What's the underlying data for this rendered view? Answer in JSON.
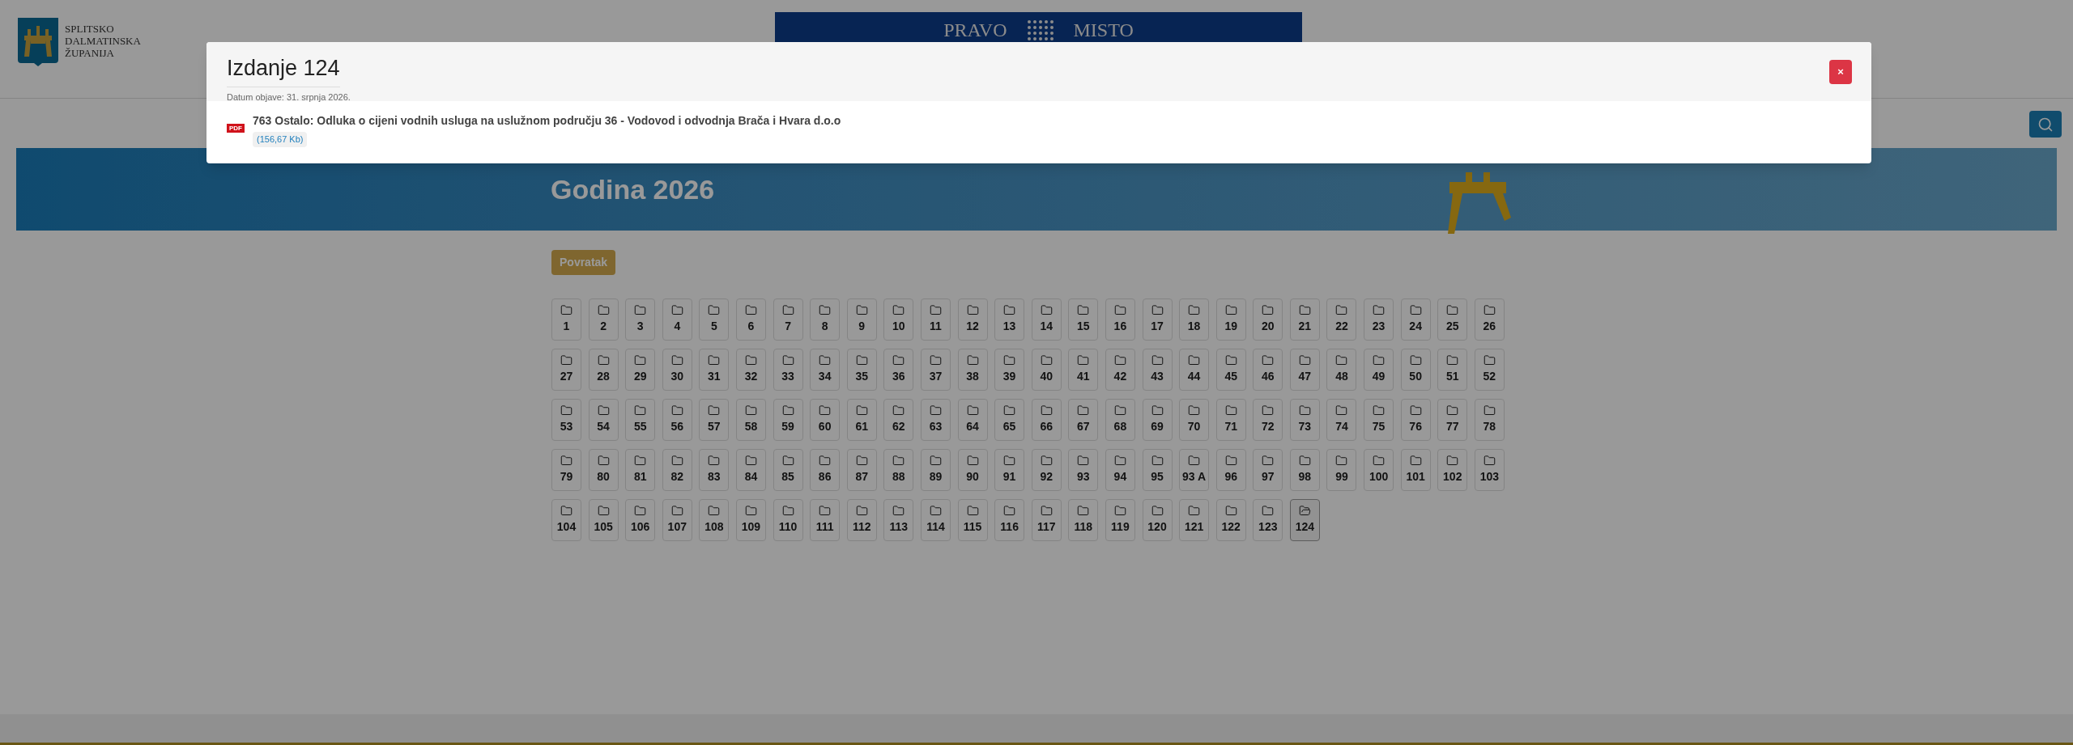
{
  "header": {
    "logo_lines": [
      "SPLITSKO",
      "DALMATINSKA",
      "ŽUPANIJA"
    ],
    "banner_words": [
      "PRAVO",
      "MISTO"
    ]
  },
  "hero": {
    "title": "Godina 2026"
  },
  "back_button": "Povratak",
  "issues": [
    {
      "label": "1",
      "selected": false
    },
    {
      "label": "2",
      "selected": false
    },
    {
      "label": "3",
      "selected": false
    },
    {
      "label": "4",
      "selected": false
    },
    {
      "label": "5",
      "selected": false
    },
    {
      "label": "6",
      "selected": false
    },
    {
      "label": "7",
      "selected": false
    },
    {
      "label": "8",
      "selected": false
    },
    {
      "label": "9",
      "selected": false
    },
    {
      "label": "10",
      "selected": false
    },
    {
      "label": "11",
      "selected": false
    },
    {
      "label": "12",
      "selected": false
    },
    {
      "label": "13",
      "selected": false
    },
    {
      "label": "14",
      "selected": false
    },
    {
      "label": "15",
      "selected": false
    },
    {
      "label": "16",
      "selected": false
    },
    {
      "label": "17",
      "selected": false
    },
    {
      "label": "18",
      "selected": false
    },
    {
      "label": "19",
      "selected": false
    },
    {
      "label": "20",
      "selected": false
    },
    {
      "label": "21",
      "selected": false
    },
    {
      "label": "22",
      "selected": false
    },
    {
      "label": "23",
      "selected": false
    },
    {
      "label": "24",
      "selected": false
    },
    {
      "label": "25",
      "selected": false
    },
    {
      "label": "26",
      "selected": false
    },
    {
      "label": "27",
      "selected": false
    },
    {
      "label": "28",
      "selected": false
    },
    {
      "label": "29",
      "selected": false
    },
    {
      "label": "30",
      "selected": false
    },
    {
      "label": "31",
      "selected": false
    },
    {
      "label": "32",
      "selected": false
    },
    {
      "label": "33",
      "selected": false
    },
    {
      "label": "34",
      "selected": false
    },
    {
      "label": "35",
      "selected": false
    },
    {
      "label": "36",
      "selected": false
    },
    {
      "label": "37",
      "selected": false
    },
    {
      "label": "38",
      "selected": false
    },
    {
      "label": "39",
      "selected": false
    },
    {
      "label": "40",
      "selected": false
    },
    {
      "label": "41",
      "selected": false
    },
    {
      "label": "42",
      "selected": false
    },
    {
      "label": "43",
      "selected": false
    },
    {
      "label": "44",
      "selected": false
    },
    {
      "label": "45",
      "selected": false
    },
    {
      "label": "46",
      "selected": false
    },
    {
      "label": "47",
      "selected": false
    },
    {
      "label": "48",
      "selected": false
    },
    {
      "label": "49",
      "selected": false
    },
    {
      "label": "50",
      "selected": false
    },
    {
      "label": "51",
      "selected": false
    },
    {
      "label": "52",
      "selected": false
    },
    {
      "label": "53",
      "selected": false
    },
    {
      "label": "54",
      "selected": false
    },
    {
      "label": "55",
      "selected": false
    },
    {
      "label": "56",
      "selected": false
    },
    {
      "label": "57",
      "selected": false
    },
    {
      "label": "58",
      "selected": false
    },
    {
      "label": "59",
      "selected": false
    },
    {
      "label": "60",
      "selected": false
    },
    {
      "label": "61",
      "selected": false
    },
    {
      "label": "62",
      "selected": false
    },
    {
      "label": "63",
      "selected": false
    },
    {
      "label": "64",
      "selected": false
    },
    {
      "label": "65",
      "selected": false
    },
    {
      "label": "66",
      "selected": false
    },
    {
      "label": "67",
      "selected": false
    },
    {
      "label": "68",
      "selected": false
    },
    {
      "label": "69",
      "selected": false
    },
    {
      "label": "70",
      "selected": false
    },
    {
      "label": "71",
      "selected": false
    },
    {
      "label": "72",
      "selected": false
    },
    {
      "label": "73",
      "selected": false
    },
    {
      "label": "74",
      "selected": false
    },
    {
      "label": "75",
      "selected": false
    },
    {
      "label": "76",
      "selected": false
    },
    {
      "label": "77",
      "selected": false
    },
    {
      "label": "78",
      "selected": false
    },
    {
      "label": "79",
      "selected": false
    },
    {
      "label": "80",
      "selected": false
    },
    {
      "label": "81",
      "selected": false
    },
    {
      "label": "82",
      "selected": false
    },
    {
      "label": "83",
      "selected": false
    },
    {
      "label": "84",
      "selected": false
    },
    {
      "label": "85",
      "selected": false
    },
    {
      "label": "86",
      "selected": false
    },
    {
      "label": "87",
      "selected": false
    },
    {
      "label": "88",
      "selected": false
    },
    {
      "label": "89",
      "selected": false
    },
    {
      "label": "90",
      "selected": false
    },
    {
      "label": "91",
      "selected": false
    },
    {
      "label": "92",
      "selected": false
    },
    {
      "label": "93",
      "selected": false
    },
    {
      "label": "94",
      "selected": false
    },
    {
      "label": "95",
      "selected": false
    },
    {
      "label": "93 A",
      "selected": false
    },
    {
      "label": "96",
      "selected": false
    },
    {
      "label": "97",
      "selected": false
    },
    {
      "label": "98",
      "selected": false
    },
    {
      "label": "99",
      "selected": false
    },
    {
      "label": "100",
      "selected": false
    },
    {
      "label": "101",
      "selected": false
    },
    {
      "label": "102",
      "selected": false
    },
    {
      "label": "103",
      "selected": false
    },
    {
      "label": "104",
      "selected": false
    },
    {
      "label": "105",
      "selected": false
    },
    {
      "label": "106",
      "selected": false
    },
    {
      "label": "107",
      "selected": false
    },
    {
      "label": "108",
      "selected": false
    },
    {
      "label": "109",
      "selected": false
    },
    {
      "label": "110",
      "selected": false
    },
    {
      "label": "111",
      "selected": false
    },
    {
      "label": "112",
      "selected": false
    },
    {
      "label": "113",
      "selected": false
    },
    {
      "label": "114",
      "selected": false
    },
    {
      "label": "115",
      "selected": false
    },
    {
      "label": "116",
      "selected": false
    },
    {
      "label": "117",
      "selected": false
    },
    {
      "label": "118",
      "selected": false
    },
    {
      "label": "119",
      "selected": false
    },
    {
      "label": "120",
      "selected": false
    },
    {
      "label": "121",
      "selected": false
    },
    {
      "label": "122",
      "selected": false
    },
    {
      "label": "123",
      "selected": false
    },
    {
      "label": "124",
      "selected": true
    }
  ],
  "modal": {
    "title": "Izdanje 124",
    "subtitle": "Datum objave: 31. srpnja 2026.",
    "close": "×",
    "files": [
      {
        "badge": "PDF",
        "title": "763 Ostalo: Odluka o cijeni vodnih usluga na uslužnom području 36 - Vodovod i odvodnja Brača i Hvara d.o.o",
        "size": "(156,67 Kb)"
      }
    ]
  }
}
